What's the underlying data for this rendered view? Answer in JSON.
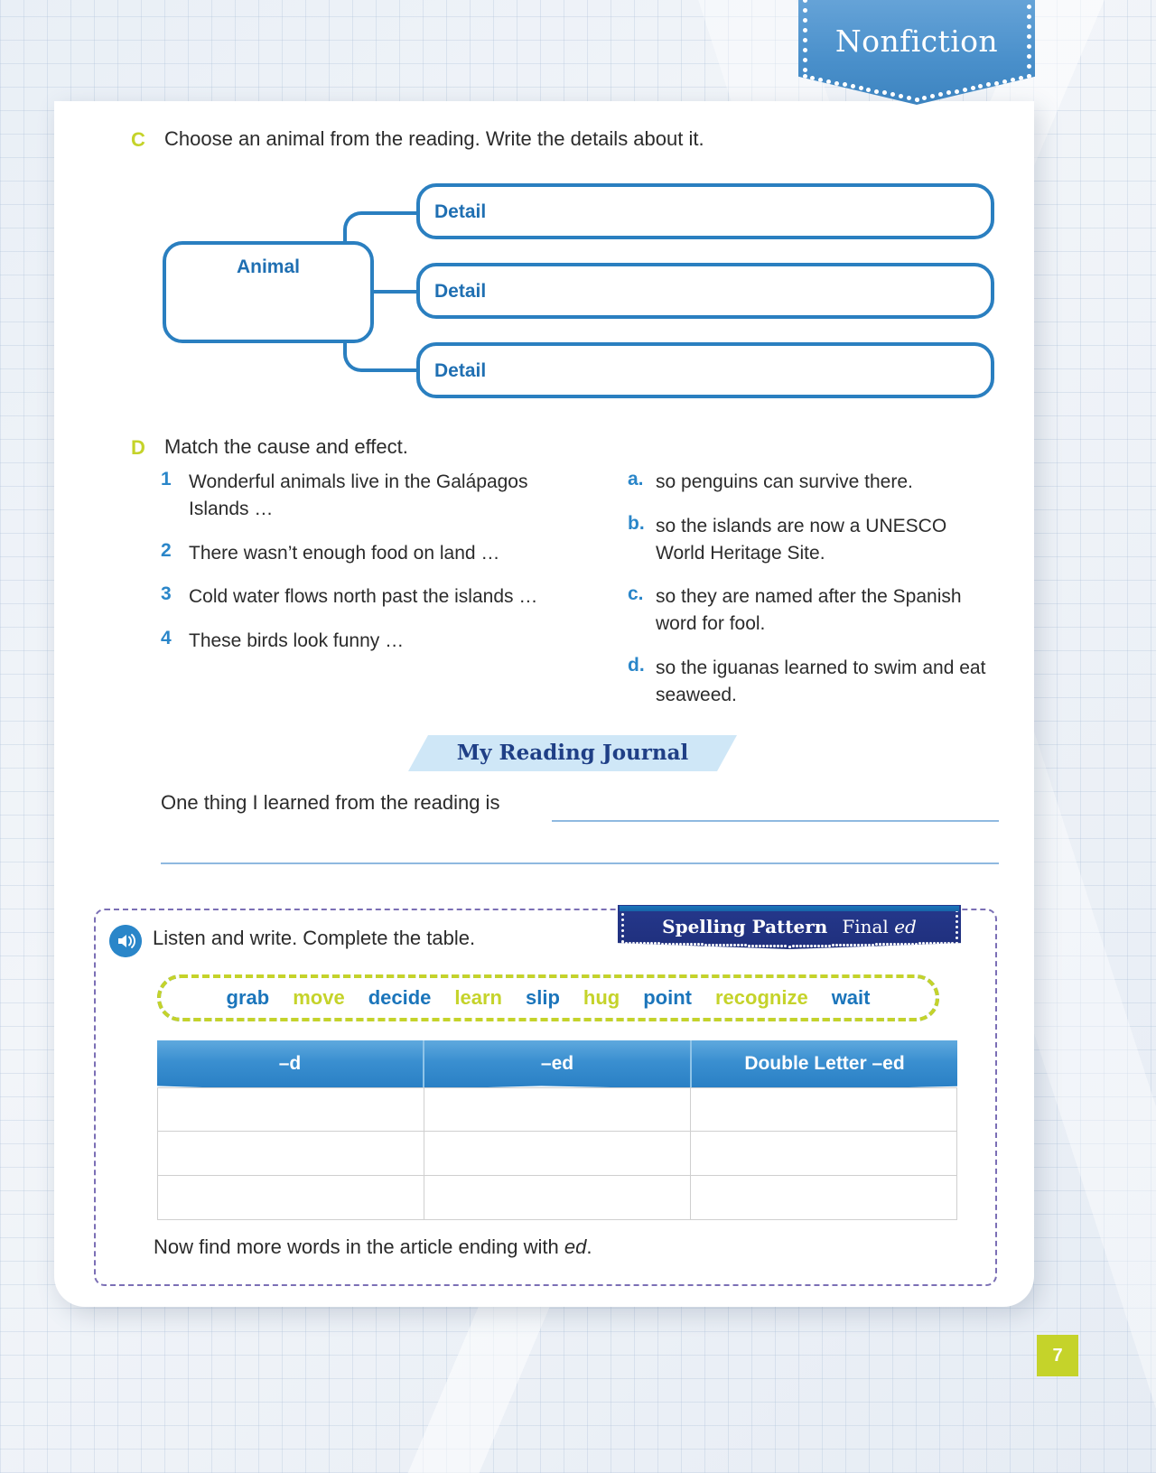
{
  "ribbon": {
    "title": "Nonfiction"
  },
  "task_c": {
    "letter": "C",
    "text": "Choose an animal from the reading. Write the details about it."
  },
  "organizer": {
    "center_label": "Animal",
    "detail_labels": [
      "Detail",
      "Detail",
      "Detail"
    ]
  },
  "task_d": {
    "letter": "D",
    "text": "Match the cause and effect.",
    "causes": [
      {
        "num": "1",
        "text": "Wonderful animals live in the Galápagos Islands …"
      },
      {
        "num": "2",
        "text": "There wasn’t enough food on land …"
      },
      {
        "num": "3",
        "text": "Cold water flows north past the islands …"
      },
      {
        "num": "4",
        "text": "These birds look funny …"
      }
    ],
    "effects": [
      {
        "num": "a.",
        "text": "so penguins can survive there."
      },
      {
        "num": "b.",
        "text": "so the islands are now a UNESCO World Heritage Site."
      },
      {
        "num": "c.",
        "text": "so they are named after the Spanish word for fool."
      },
      {
        "num": "d.",
        "text": "so the iguanas learned to swim and eat seaweed."
      }
    ]
  },
  "journal": {
    "banner": "My Reading Journal",
    "prompt": "One thing I learned from the reading is"
  },
  "spelling": {
    "tab_title": "Spelling Pattern",
    "tab_pattern_prefix": "Final ",
    "tab_pattern_italic": "ed",
    "audio_icon": "speaker-icon",
    "instruction": "Listen and write. Complete the table.",
    "word_bank": [
      {
        "word": "grab",
        "color": "blue"
      },
      {
        "word": "move",
        "color": "lime"
      },
      {
        "word": "decide",
        "color": "blue"
      },
      {
        "word": "learn",
        "color": "lime"
      },
      {
        "word": "slip",
        "color": "blue"
      },
      {
        "word": "hug",
        "color": "lime"
      },
      {
        "word": "point",
        "color": "blue"
      },
      {
        "word": "recognize",
        "color": "lime"
      },
      {
        "word": "wait",
        "color": "blue"
      }
    ],
    "table_headers": [
      "–d",
      "–ed",
      "Double Letter –ed"
    ],
    "table_rows": [
      [
        "",
        "",
        ""
      ],
      [
        "",
        "",
        ""
      ],
      [
        "",
        "",
        ""
      ]
    ],
    "footer_prefix": "Now find more words in the article ending with ",
    "footer_italic": "ed",
    "footer_suffix": "."
  },
  "page_number": "7",
  "colors": {
    "accent_blue": "#2a7fc0",
    "accent_lime": "#c5d32a",
    "navy": "#1f2f7c",
    "light_blue": "#cfe7f7"
  }
}
